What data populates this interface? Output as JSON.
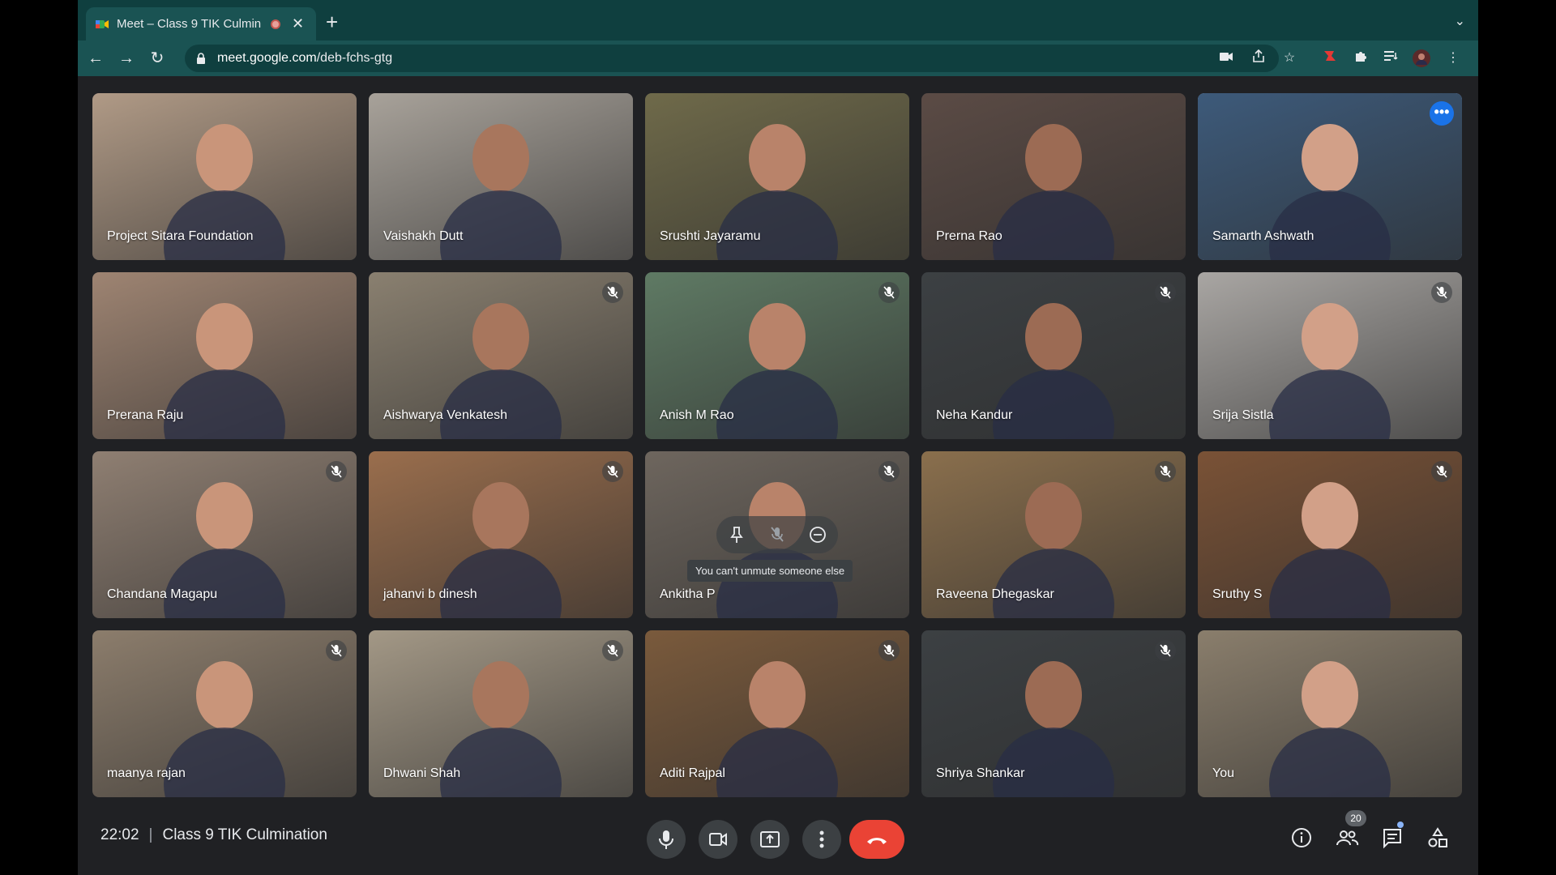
{
  "browser": {
    "tab_title": "Meet – Class 9 TIK Culmin",
    "url_host": "meet.google.com",
    "url_path": "/deb-fchs-gtg"
  },
  "tiles": [
    {
      "name": "Project Sitara Foundation",
      "muted": false,
      "bg": "#b09a86"
    },
    {
      "name": "Vaishakh Dutt",
      "muted": false,
      "bg": "#a8a29a"
    },
    {
      "name": "Srushti Jayaramu",
      "muted": false,
      "bg": "#6f6a4a"
    },
    {
      "name": "Prerna Rao",
      "muted": false,
      "bg": "#5b4b45"
    },
    {
      "name": "Samarth Ashwath",
      "muted": false,
      "bg": "#3d5a7a",
      "active": true
    },
    {
      "name": "Prerana Raju",
      "muted": false,
      "bg": "#9e8472"
    },
    {
      "name": "Aishwarya Venkatesh",
      "muted": true,
      "bg": "#8a8070"
    },
    {
      "name": "Anish M Rao",
      "muted": true,
      "bg": "#5f7a64"
    },
    {
      "name": "Neha Kandur",
      "muted": true,
      "bg": "#3c4043"
    },
    {
      "name": "Srija Sistla",
      "muted": true,
      "bg": "#a9a6a3"
    },
    {
      "name": "Chandana Magapu",
      "muted": true,
      "bg": "#8f7f72"
    },
    {
      "name": "jahanvi b dinesh",
      "muted": true,
      "bg": "#9a6e4d"
    },
    {
      "name": "Ankitha P",
      "muted": true,
      "bg": "#6e665e"
    },
    {
      "name": "Raveena Dhegaskar",
      "muted": true,
      "bg": "#8a6f4d"
    },
    {
      "name": "Sruthy S",
      "muted": true,
      "bg": "#7a5236"
    },
    {
      "name": "maanya rajan",
      "muted": true,
      "bg": "#8c7d6c"
    },
    {
      "name": "Dhwani Shah",
      "muted": true,
      "bg": "#a39886"
    },
    {
      "name": "Aditi Rajpal",
      "muted": true,
      "bg": "#7a5a3c"
    },
    {
      "name": "Shriya Shankar",
      "muted": true,
      "bg": "#3c4043"
    },
    {
      "name": "You",
      "muted": false,
      "bg": "#8a7e6c"
    }
  ],
  "hover_tooltip": "You can't unmute someone else",
  "bottom": {
    "time": "22:02",
    "separator": "|",
    "meeting_title": "Class 9 TIK Culmination",
    "people_count": "20"
  },
  "icons": {
    "favicon": "meet-icon",
    "mic": "mic-icon",
    "camera": "camera-icon",
    "present": "present-icon",
    "more": "more-vert-icon",
    "end": "end-call-icon",
    "info": "info-icon",
    "people": "people-icon",
    "chat": "chat-icon",
    "activities": "activities-icon"
  },
  "colors": {
    "accent": "#8ab4f8",
    "end_call": "#ea4335",
    "meet_bg": "#202124",
    "chrome_tab": "#0f3f3f"
  }
}
